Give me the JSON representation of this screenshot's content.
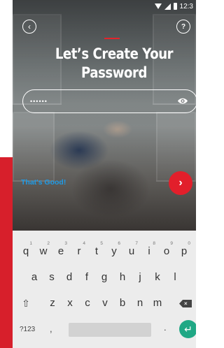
{
  "status_bar": {
    "time": "12:3"
  },
  "nav": {
    "back_icon": "chevron-left-icon",
    "help_label": "?"
  },
  "title": "Let’s Create Your Password",
  "password_field": {
    "value": "••••••"
  },
  "strength_text": "That's Good!",
  "next_button": {
    "icon": "chevron-right-icon",
    "label": "›"
  },
  "colors": {
    "accent": "#e21f2b",
    "strength": "#1e9be6",
    "enter": "#20a885"
  },
  "keyboard": {
    "row1": [
      {
        "key": "q",
        "hint": "1"
      },
      {
        "key": "w",
        "hint": "2"
      },
      {
        "key": "e",
        "hint": "3"
      },
      {
        "key": "r",
        "hint": "4"
      },
      {
        "key": "t",
        "hint": "5"
      },
      {
        "key": "y",
        "hint": "6"
      },
      {
        "key": "u",
        "hint": "7"
      },
      {
        "key": "i",
        "hint": "8"
      },
      {
        "key": "o",
        "hint": "9"
      },
      {
        "key": "p",
        "hint": "0"
      }
    ],
    "row2": [
      "a",
      "s",
      "d",
      "f",
      "g",
      "h",
      "j",
      "k",
      "l"
    ],
    "row3": [
      "z",
      "x",
      "c",
      "v",
      "b",
      "n",
      "m"
    ],
    "shift_label": "⇧",
    "delete_label": "×",
    "symbols_label": "?123",
    "comma_label": ",",
    "period_label": ".",
    "enter_label": "↵"
  }
}
